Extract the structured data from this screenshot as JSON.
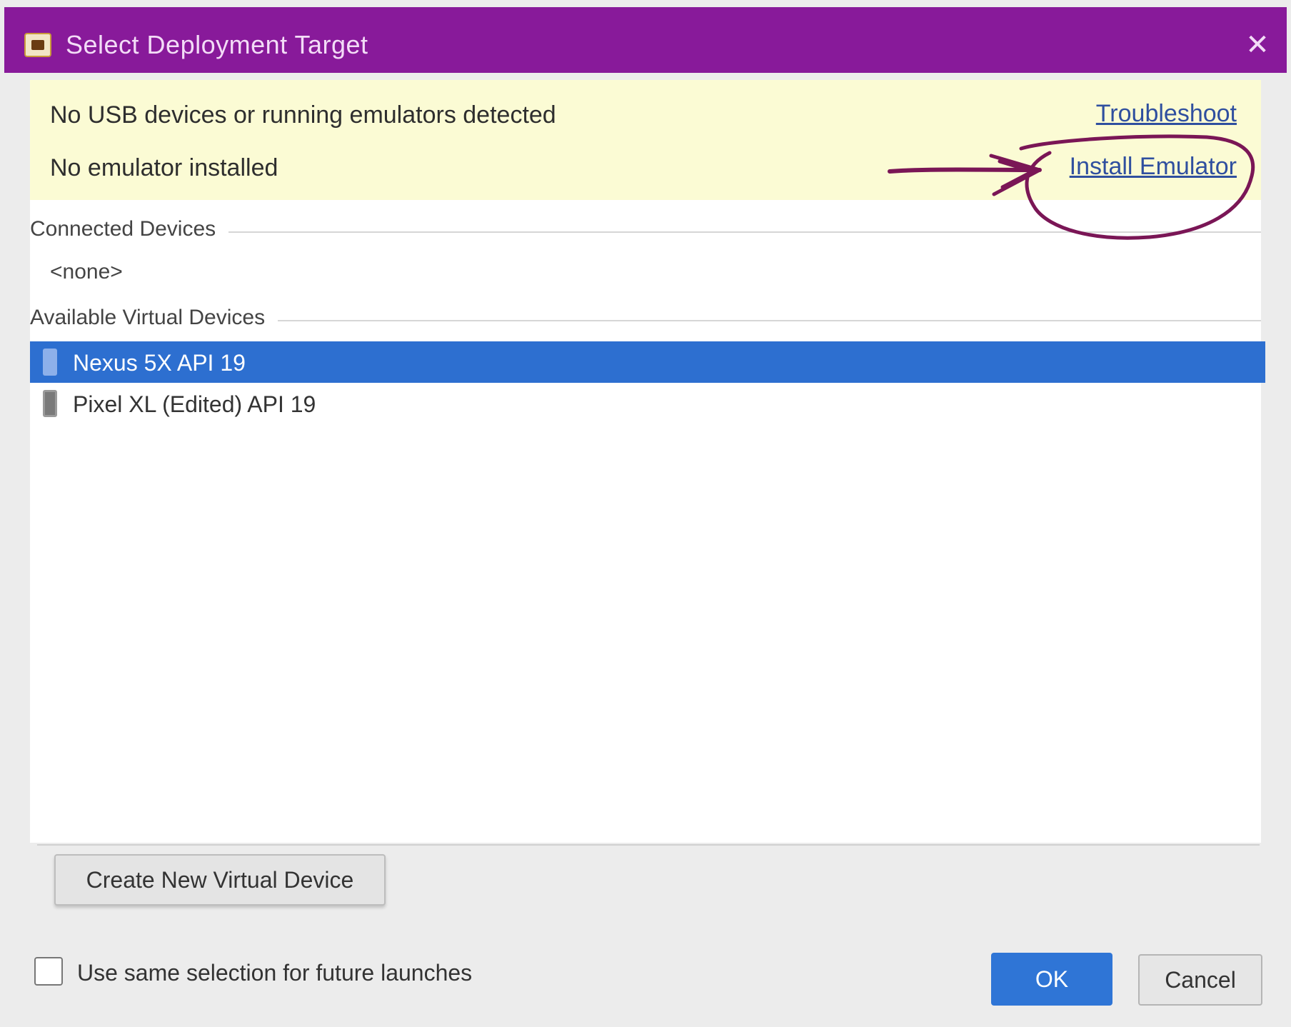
{
  "window": {
    "title": "Select Deployment Target",
    "close_glyph": "✕",
    "title_bar_color": "#881a9a",
    "icon": "android-studio-icon"
  },
  "banner": {
    "background": "#fbfbd4",
    "message_usb": "No USB devices or running emulators detected",
    "message_emulator": "No emulator installed",
    "link_troubleshoot": "Troubleshoot",
    "link_install_emulator": "Install Emulator"
  },
  "connected_devices": {
    "header": "Connected Devices",
    "empty_text": "<none>"
  },
  "available_virtual_devices": {
    "header": "Available Virtual Devices",
    "items": [
      {
        "name": "Nexus 5X API 19",
        "selected": true,
        "icon": "phone-icon"
      },
      {
        "name": "Pixel XL (Edited) API 19",
        "selected": false,
        "icon": "phone-icon"
      }
    ],
    "selection_color": "#2d6fd0"
  },
  "footer": {
    "create_device_label": "Create New Virtual Device",
    "future_checkbox_label": "Use same selection for future launches",
    "future_checkbox_checked": false,
    "ok_label": "OK",
    "cancel_label": "Cancel",
    "ok_color": "#2f75d6"
  },
  "annotation": {
    "type": "hand-drawn circle and arrow around Install Emulator link",
    "color": "#7a1656"
  }
}
